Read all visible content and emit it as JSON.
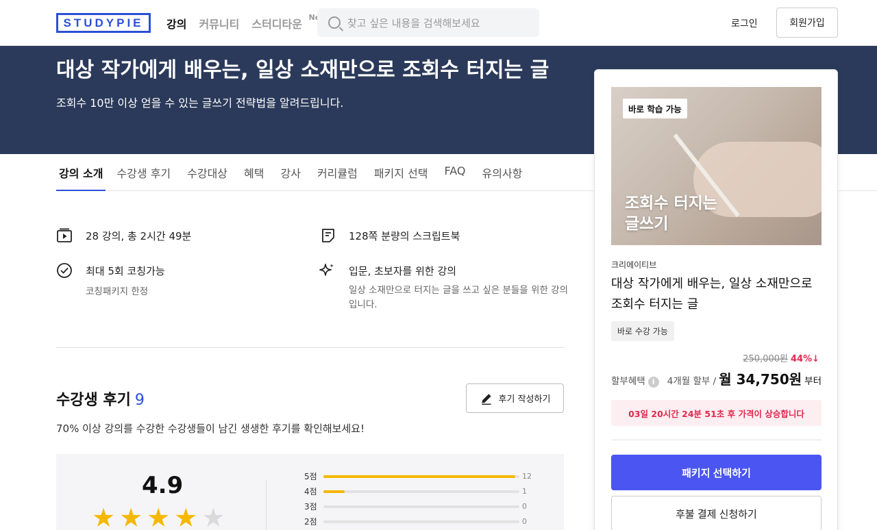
{
  "header": {
    "logo": "STUDYPIE",
    "nav": [
      {
        "label": "강의",
        "active": true
      },
      {
        "label": "커뮤니티",
        "active": false
      },
      {
        "label": "스터디타운",
        "active": false,
        "badge": "New"
      }
    ],
    "search_placeholder": "찾고 싶은 내용을 검색해보세요",
    "login": "로그인",
    "signup": "회원가입"
  },
  "hero": {
    "title": "대상 작가에게 배우는, 일상 소재만으로 조회수 터지는 글",
    "subtitle": "조회수 10만 이상 얻을 수 있는 글쓰기 전략법을 알려드립니다."
  },
  "tabs": [
    "강의 소개",
    "수강생 후기",
    "수강대상",
    "혜택",
    "강사",
    "커리큘럼",
    "패키지 선택",
    "FAQ",
    "유의사항"
  ],
  "features": {
    "lectures": "28 강의, 총 2시간 49분",
    "script": "128쪽 분량의 스크립트북",
    "coaching": "최대 5회 코칭가능",
    "coaching_sub": "코칭패키지 한정",
    "level": "입문, 초보자를 위한 강의",
    "level_sub": "일상 소재만으로 터지는 글을 쓰고 싶은 분들을 위한 강의입니다."
  },
  "reviews": {
    "title": "수강생 후기",
    "count": "9",
    "write_button": "후기 작성하기",
    "description": "70% 이상 강의를 수강한 수강생들이 남긴 생생한 후기를 확인해보세요!",
    "score": "4.9",
    "star_rating": 4,
    "distribution": [
      {
        "label": "5점",
        "count": "12",
        "fraction": 0.98
      },
      {
        "label": "4점",
        "count": "1",
        "fraction": 0.11
      },
      {
        "label": "3점",
        "count": "0",
        "fraction": 0
      },
      {
        "label": "2점",
        "count": "0",
        "fraction": 0
      }
    ]
  },
  "card": {
    "badge": "바로 학습 가능",
    "thumb_text": "조회수 터지는\n글쓰기",
    "creator": "크리에이티브",
    "title": "대상 작가에게 배우는, 일상 소재만으로 조회수 터지는 글",
    "tag": "바로 수강 가능",
    "original_price": "250,000원",
    "discount": "44%↓",
    "installment_label": "할부혜택",
    "installment_months": "4개월 할부 /",
    "monthly_price": "월 34,750원",
    "monthly_suffix": "부터",
    "countdown": "03일 20시간 24분 51초 후 가격이 상승합니다",
    "primary_button": "패키지 선택하기",
    "secondary_button": "후불 결제 신청하기"
  },
  "colors": {
    "brand": "#2b50d6",
    "hero_bg": "#2b3a5a",
    "accent_red": "#e0284f",
    "primary_button": "#4a55f2",
    "star": "#f5b800"
  }
}
